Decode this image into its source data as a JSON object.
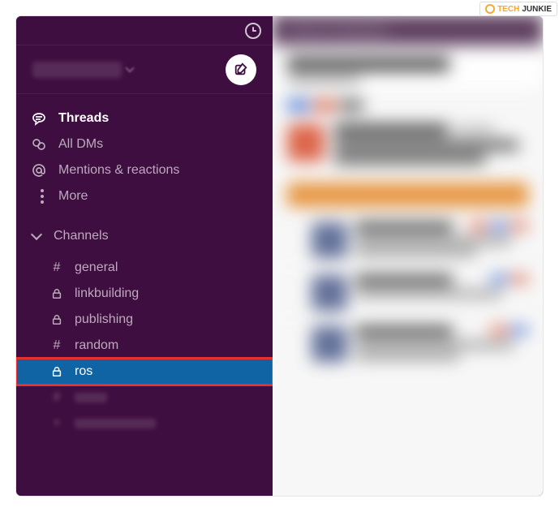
{
  "watermark": {
    "tech": "TECH",
    "junkie": "JUNKIE",
    "logo": "TJ"
  },
  "sidebar": {
    "nav": {
      "threads": "Threads",
      "all_dms": "All DMs",
      "mentions": "Mentions & reactions",
      "more": "More"
    },
    "channels_header": "Channels",
    "channels": [
      {
        "prefix": "#",
        "name": "general"
      },
      {
        "prefix": "lock",
        "name": "linkbuilding"
      },
      {
        "prefix": "lock",
        "name": "publishing"
      },
      {
        "prefix": "#",
        "name": "random"
      },
      {
        "prefix": "lock",
        "name": "ros"
      }
    ]
  }
}
